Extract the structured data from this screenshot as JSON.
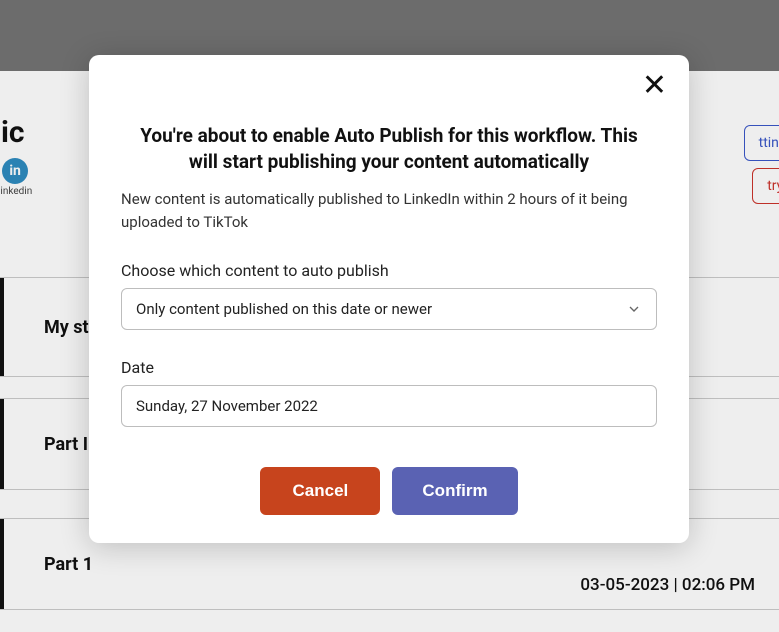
{
  "background": {
    "title": "Public",
    "linkedin_label": "linkedin",
    "settings_label": "ttings",
    "retry_label": "try Failed",
    "rows": [
      {
        "title": "My st",
        "date": ""
      },
      {
        "title": "Part II",
        "date": ""
      },
      {
        "title": "Part 1",
        "date": "03-05-2023 | 02:06 PM"
      }
    ]
  },
  "modal": {
    "title": "You're about to enable Auto Publish for this workflow. This will start publishing your content automatically",
    "description": "New content is automatically published to LinkedIn within 2 hours of it being uploaded to TikTok",
    "choose_label": "Choose which content to auto publish",
    "select_value": "Only content published on this date or newer",
    "date_label": "Date",
    "date_value": "Sunday, 27 November 2022",
    "cancel_label": "Cancel",
    "confirm_label": "Confirm"
  }
}
